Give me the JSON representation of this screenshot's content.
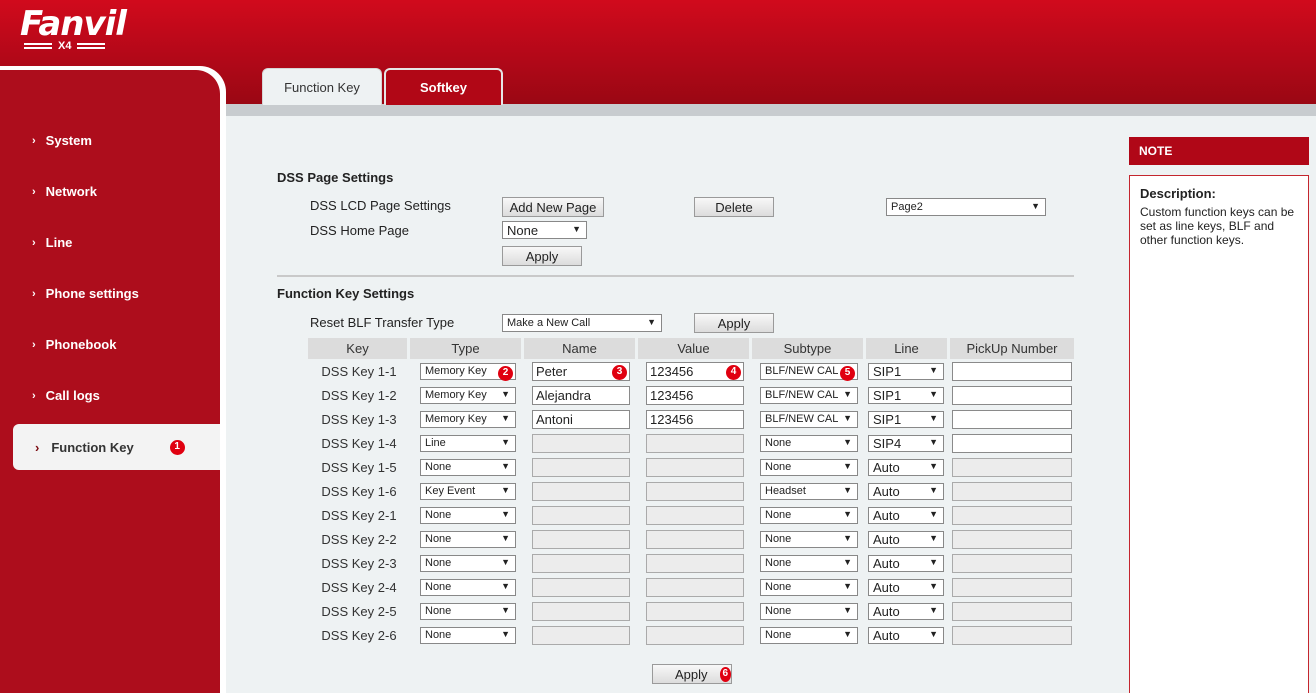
{
  "brand": {
    "name": "Fanvil",
    "model": "X4"
  },
  "tabs": [
    {
      "label": "Function Key",
      "active": false
    },
    {
      "label": "Softkey",
      "active": true
    }
  ],
  "sidebar": {
    "items": [
      {
        "label": "System"
      },
      {
        "label": "Network"
      },
      {
        "label": "Line"
      },
      {
        "label": "Phone settings"
      },
      {
        "label": "Phonebook"
      },
      {
        "label": "Call logs"
      }
    ],
    "active_item": {
      "label": "Function Key",
      "badge": "1"
    }
  },
  "dss_page": {
    "title": "DSS Page Settings",
    "lcd_label": "DSS LCD Page Settings",
    "add_new_page": "Add New Page",
    "delete": "Delete",
    "page_select": "Page2",
    "home_label": "DSS Home Page",
    "home_select": "None",
    "apply": "Apply"
  },
  "fk_settings": {
    "title": "Function Key Settings",
    "reset_label": "Reset BLF Transfer Type",
    "reset_select": "Make a New Call",
    "apply": "Apply"
  },
  "table": {
    "headers": [
      "Key",
      "Type",
      "Name",
      "Value",
      "Subtype",
      "Line",
      "PickUp Number"
    ],
    "rows": [
      {
        "key": "DSS Key 1-1",
        "type": "Memory Key",
        "name": "Peter",
        "value": "123456",
        "subtype": "BLF/NEW CAL",
        "line": "SIP1",
        "pickup": "",
        "editable": true
      },
      {
        "key": "DSS Key 1-2",
        "type": "Memory Key",
        "name": "Alejandra",
        "value": "123456",
        "subtype": "BLF/NEW CAL",
        "line": "SIP1",
        "pickup": "",
        "editable": true
      },
      {
        "key": "DSS Key 1-3",
        "type": "Memory Key",
        "name": "Antoni",
        "value": "123456",
        "subtype": "BLF/NEW CAL",
        "line": "SIP1",
        "pickup": "",
        "editable": true
      },
      {
        "key": "DSS Key 1-4",
        "type": "Line",
        "name": "",
        "value": "",
        "subtype": "None",
        "line": "SIP4",
        "pickup": "",
        "editable": false
      },
      {
        "key": "DSS Key 1-5",
        "type": "None",
        "name": "",
        "value": "",
        "subtype": "None",
        "line": "Auto",
        "pickup": "",
        "editable": false
      },
      {
        "key": "DSS Key 1-6",
        "type": "Key Event",
        "name": "",
        "value": "",
        "subtype": "Headset",
        "line": "Auto",
        "pickup": "",
        "editable": false
      },
      {
        "key": "DSS Key 2-1",
        "type": "None",
        "name": "",
        "value": "",
        "subtype": "None",
        "line": "Auto",
        "pickup": "",
        "editable": false
      },
      {
        "key": "DSS Key 2-2",
        "type": "None",
        "name": "",
        "value": "",
        "subtype": "None",
        "line": "Auto",
        "pickup": "",
        "editable": false
      },
      {
        "key": "DSS Key 2-3",
        "type": "None",
        "name": "",
        "value": "",
        "subtype": "None",
        "line": "Auto",
        "pickup": "",
        "editable": false
      },
      {
        "key": "DSS Key 2-4",
        "type": "None",
        "name": "",
        "value": "",
        "subtype": "None",
        "line": "Auto",
        "pickup": "",
        "editable": false
      },
      {
        "key": "DSS Key 2-5",
        "type": "None",
        "name": "",
        "value": "",
        "subtype": "None",
        "line": "Auto",
        "pickup": "",
        "editable": false
      },
      {
        "key": "DSS Key 2-6",
        "type": "None",
        "name": "",
        "value": "",
        "subtype": "None",
        "line": "Auto",
        "pickup": "",
        "editable": false
      }
    ],
    "badges": {
      "type": "2",
      "name": "3",
      "value": "4",
      "subtype": "5"
    }
  },
  "bottom_apply": {
    "label": "Apply",
    "badge": "6"
  },
  "note": {
    "header": "NOTE",
    "title": "Description:",
    "text": "Custom function keys can be set as line keys, BLF and other function keys."
  },
  "colors": {
    "brand_red": "#b00717",
    "badge_red": "#e00010"
  },
  "icons": {
    "nav_chevron": "chevron-right-icon",
    "select_arrow": "dropdown-arrow-icon"
  }
}
